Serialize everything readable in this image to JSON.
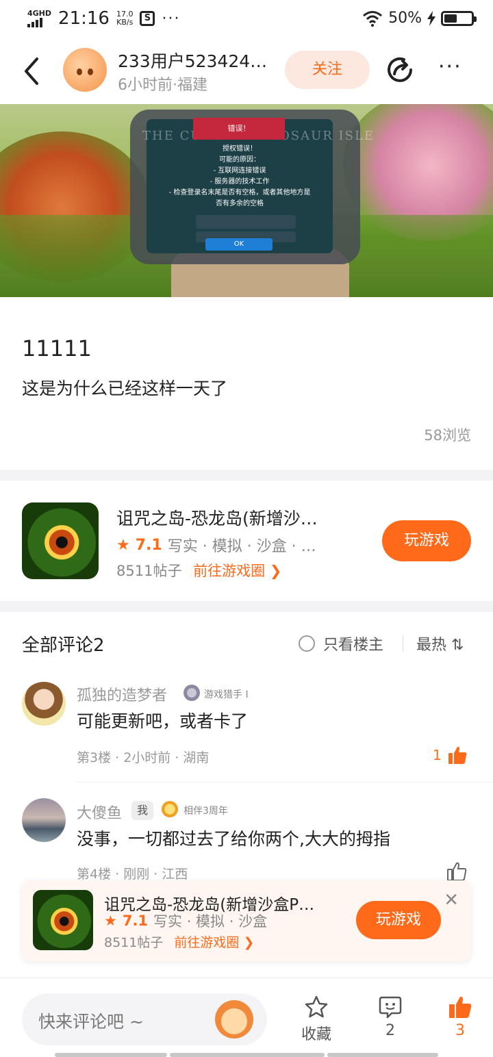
{
  "status_bar": {
    "network": "4GHD",
    "time": "21:16",
    "speed": "17.0",
    "speed_unit": "KB/s",
    "s_icon": "S",
    "dots": "···",
    "battery": "50%"
  },
  "nav": {
    "user_name": "233用户523424…",
    "user_meta": "6小时前·福建",
    "follow_label": "关注",
    "more": "···"
  },
  "screenshot_dialog": {
    "ghost_title": "THE CURSED DINOSAUR ISLE",
    "title": "错误！",
    "lines": [
      "授权错误！",
      "可能的原因：",
      "- 互联网连接错误",
      "- 服务器的技术工作",
      "- 检查登录名末尾是否有空格，或者其他地方是",
      "否有多余的空格"
    ],
    "ok": "OK"
  },
  "post": {
    "title": "11111",
    "body": "这是为什么已经这样一天了",
    "views": "58浏览"
  },
  "game_card": {
    "name": "诅咒之岛-恐龙岛(新增沙…",
    "rating": "7.1",
    "tags": "写实 · 模拟 · 沙盒 · …",
    "posts": "8511帖子",
    "link": "前往游戏圈 ❯",
    "play_label": "玩游戏"
  },
  "comments_header": {
    "title": "全部评论2",
    "only_owner": "只看楼主",
    "sort": "最热 ⇅"
  },
  "comments": [
    {
      "name": "孤独的造梦者",
      "badge": "游戏猎手 I",
      "text": "可能更新吧，或者卡了",
      "meta": "第3楼 · 2小时前 · 湖南",
      "likes": "1"
    },
    {
      "name": "大傻鱼",
      "me_tag": "我",
      "badge": "相伴3周年",
      "text": "没事，一切都过去了给你两个,大大的拇指",
      "meta": "第4楼 · 刚刚 · 江西",
      "likes": ""
    }
  ],
  "float_card": {
    "name": "诅咒之岛-恐龙岛(新增沙盒P…",
    "rating": "7.1",
    "tags": "写实 · 模拟 · 沙盒",
    "posts": "8511帖子",
    "link": "前往游戏圈 ❯",
    "play_label": "玩游戏",
    "close": "✕"
  },
  "bottom_bar": {
    "comment_placeholder": "快来评论吧 ~",
    "favorite_label": "收藏",
    "comment_count": "2",
    "like_count": "3"
  },
  "colors": {
    "accent": "#ff6a1a",
    "follow_bg": "#fde8df",
    "divider": "#f3f3f5"
  }
}
